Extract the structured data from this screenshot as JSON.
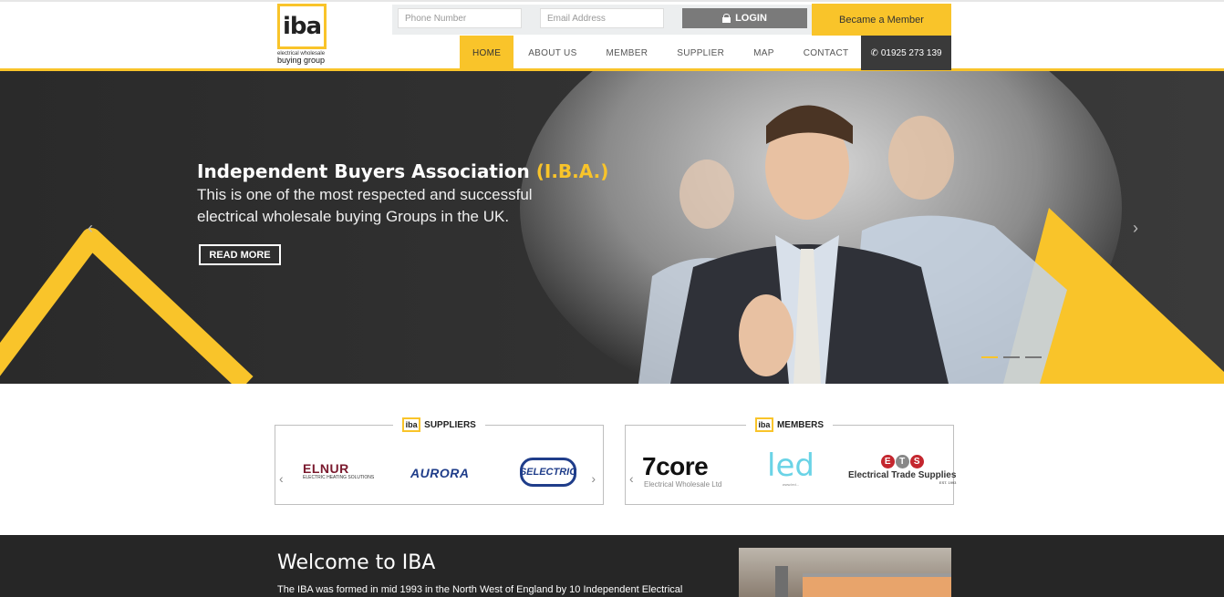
{
  "brand": {
    "logo_text": "iba",
    "tagline_small": "electrical wholesale",
    "tagline_large": "buying group"
  },
  "topbar": {
    "phone_placeholder": "Phone Number",
    "email_placeholder": "Email Address",
    "login_label": "LOGIN",
    "member_label": "Became a Member"
  },
  "nav": {
    "items": [
      {
        "label": "HOME"
      },
      {
        "label": "ABOUT US"
      },
      {
        "label": "MEMBER"
      },
      {
        "label": "SUPPLIER"
      },
      {
        "label": "MAP"
      },
      {
        "label": "CONTACT"
      }
    ],
    "phone": "01925 273 139"
  },
  "hero": {
    "title": "Independent Buyers Association",
    "title_accent": "(I.B.A.)",
    "subtitle_line1": "This is one of the most respected and successful",
    "subtitle_line2": "electrical wholesale buying Groups in the UK.",
    "cta": "READ MORE",
    "prev_arrow": "‹",
    "next_arrow": "›",
    "slide_count": 3,
    "active_slide": 1
  },
  "suppliers": {
    "heading": "SUPPLIERS",
    "badge": "iba",
    "logos": [
      {
        "name": "ELNUR",
        "tagline": "ELECTRIC HEATING SOLUTIONS"
      },
      {
        "name": "AURORA"
      },
      {
        "name": "SELECTRIC"
      }
    ]
  },
  "members": {
    "heading": "MEMBERS",
    "badge": "iba",
    "logos": [
      {
        "name": "7core",
        "tagline": "Electrical Wholesale Ltd"
      },
      {
        "name": "led",
        "tagline": "www.led..."
      },
      {
        "name": "ETS",
        "tagline": "Electrical Trade Supplies",
        "since": "EST. 1993"
      }
    ]
  },
  "welcome": {
    "title": "Welcome to IBA",
    "text": "The IBA was formed in mid 1993 in the North West of England by 10 Independent Electrical"
  },
  "colors": {
    "accent": "#f9c42a",
    "dark": "#262626",
    "nav_phone_bg": "#3a3a3a"
  }
}
